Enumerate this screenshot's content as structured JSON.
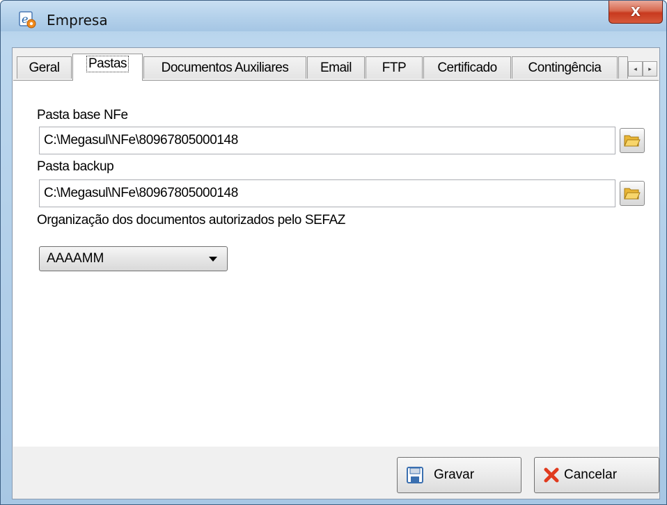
{
  "window": {
    "title": "Empresa",
    "close_glyph": "X"
  },
  "tabs": [
    {
      "label": "Geral",
      "active": false
    },
    {
      "label": "Pastas",
      "active": true
    },
    {
      "label": "Documentos Auxiliares",
      "active": false
    },
    {
      "label": "Email",
      "active": false
    },
    {
      "label": "FTP",
      "active": false
    },
    {
      "label": "Certificado",
      "active": false
    },
    {
      "label": "Contingência",
      "active": false
    }
  ],
  "tab_scroll": {
    "left_glyph": "◂",
    "right_glyph": "▸"
  },
  "pastas": {
    "base_label": "Pasta base NFe",
    "base_value": "C:\\Megasul\\NFe\\80967805000148",
    "backup_label": "Pasta backup",
    "backup_value": "C:\\Megasul\\NFe\\80967805000148",
    "organizacao_label": "Organização dos documentos autorizados pelo SEFAZ",
    "organizacao_value": "AAAAMM"
  },
  "buttons": {
    "gravar": "Gravar",
    "cancelar": "Cancelar"
  },
  "icons": {
    "app": "app-logo-icon",
    "browse": "folder-open-icon",
    "save": "floppy-disk-icon",
    "cancel": "red-x-icon"
  },
  "colors": {
    "titlebar": "#b7d3ec",
    "close_button": "#c8391e",
    "folder": "#f2c94c",
    "save_icon": "#3a6fb0",
    "cancel_icon": "#e03a1e"
  }
}
